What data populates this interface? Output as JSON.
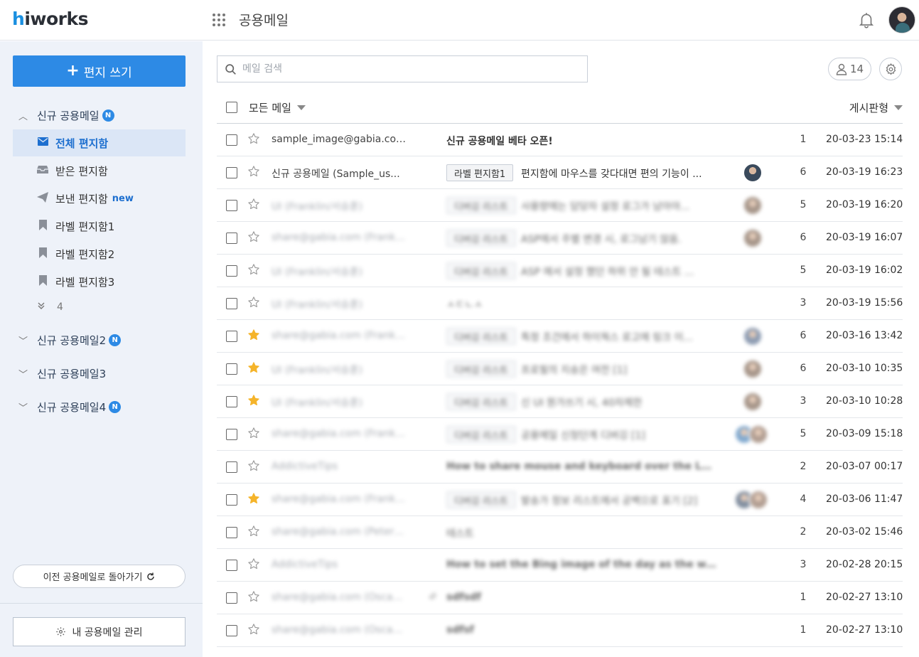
{
  "header": {
    "logo_prefix": "h",
    "logo_rest": "iworks",
    "app_title": "공용메일"
  },
  "sidebar": {
    "compose_label": "편지 쓰기",
    "mailboxes": [
      {
        "name": "신규 공용메일",
        "badge": "N",
        "expanded": true
      },
      {
        "name": "신규 공용메일2",
        "badge": "N",
        "expanded": false
      },
      {
        "name": "신규 공용메일3",
        "badge": "",
        "expanded": false
      },
      {
        "name": "신규 공용메일4",
        "badge": "N",
        "expanded": false
      }
    ],
    "folders": [
      {
        "label": "전체 편지함",
        "icon": "envelope-icon",
        "active": true,
        "tag": ""
      },
      {
        "label": "받은 편지함",
        "icon": "inbox-icon",
        "active": false,
        "tag": ""
      },
      {
        "label": "보낸 편지함",
        "icon": "send-icon",
        "active": false,
        "tag": "new"
      },
      {
        "label": "라벨 편지함1",
        "icon": "bookmark-icon",
        "active": false,
        "tag": ""
      },
      {
        "label": "라벨 편지함2",
        "icon": "bookmark-icon",
        "active": false,
        "tag": ""
      },
      {
        "label": "라벨 편지함3",
        "icon": "bookmark-icon",
        "active": false,
        "tag": ""
      }
    ],
    "more_count": "4",
    "back_label": "이전 공용메일로 돌아가기",
    "manage_label": "내 공용메일 관리"
  },
  "toolbar": {
    "search_placeholder": "메일 검색",
    "member_count": "14",
    "filter_label": "모든 메일",
    "view_label": "게시판형"
  },
  "colors": {
    "accent": "#2d8ae5",
    "star_filled": "#f5b42a",
    "sidebar_bg": "#eef2f9"
  },
  "mails": [
    {
      "sender": "sample_image@gabia.com...",
      "label": "",
      "subject": "신규 공용메일 베타 오픈!",
      "bold": true,
      "count": "1",
      "date": "20-03-23 15:14",
      "starred": false,
      "blur": false,
      "avatars": [],
      "clip": false
    },
    {
      "sender": "신규 공용메일 (Sample_us...",
      "label": "라벨 편지함1",
      "subject": "편지함에 마우스를 갖다대면 편의 기능이 ...",
      "bold": false,
      "count": "6",
      "date": "20-03-19 16:23",
      "starred": false,
      "blur": false,
      "avatars": [
        "#3a4a5c"
      ],
      "clip": false
    },
    {
      "sender": "UI (Franklin/서승훈)",
      "label": "디버깅 리스트",
      "subject": "사용량에는 담당자 설정 로그가 남아야...",
      "bold": false,
      "count": "5",
      "date": "20-03-19 16:20",
      "starred": false,
      "blur": true,
      "avatars": [
        "#8b7565"
      ],
      "clip": false
    },
    {
      "sender": "share@gabia.com (Frankli...",
      "label": "디버깅 리스트",
      "subject": "ASP에서 주별 변경 시, 로그남기 않음.",
      "bold": false,
      "count": "6",
      "date": "20-03-19 16:07",
      "starred": false,
      "blur": true,
      "avatars": [
        "#8b7565"
      ],
      "clip": false
    },
    {
      "sender": "UI (Franklin/서승훈)",
      "label": "디버깅 리스트",
      "subject": "ASP 에서 설정 했던 하위 안 될 테스트 ...",
      "bold": false,
      "count": "5",
      "date": "20-03-19 16:02",
      "starred": false,
      "blur": true,
      "avatars": [],
      "clip": false
    },
    {
      "sender": "UI (Franklin/서승훈)",
      "label": "",
      "subject": "ㅅㄷㄴㅅ",
      "bold": false,
      "count": "3",
      "date": "20-03-19 15:56",
      "starred": false,
      "blur": true,
      "avatars": [],
      "clip": false
    },
    {
      "sender": "share@gabia.com (Frankli...",
      "label": "디버깅 리스트",
      "subject": "특정 조건에서 하이웍스 로고에 링크 이...",
      "bold": false,
      "count": "6",
      "date": "20-03-16 13:42",
      "starred": true,
      "blur": true,
      "avatars": [
        "#6a7d9a"
      ],
      "clip": false
    },
    {
      "sender": "UI (Franklin/서승훈)",
      "label": "디버깅 리스트",
      "subject": "프로필의 지송은 여전 [1]",
      "bold": false,
      "count": "6",
      "date": "20-03-10 10:35",
      "starred": true,
      "blur": true,
      "avatars": [
        "#8b7565"
      ],
      "clip": false
    },
    {
      "sender": "UI (Franklin/서승훈)",
      "label": "디버깅 리스트",
      "subject": "신 UI 뭔가쓰기 시, 40자제한",
      "bold": false,
      "count": "3",
      "date": "20-03-10 10:28",
      "starred": true,
      "blur": true,
      "avatars": [
        "#8b7565"
      ],
      "clip": false
    },
    {
      "sender": "share@gabia.com (Frankli...",
      "label": "디버깅 리스트",
      "subject": "공용메일 신청단계 디버깅 [1]",
      "bold": false,
      "count": "5",
      "date": "20-03-09 15:18",
      "starred": false,
      "blur": true,
      "avatars": [
        "#5b8fc0",
        "#9a8070"
      ],
      "clip": false
    },
    {
      "sender": "AddictiveTips",
      "label": "",
      "subject": "How to share mouse and keyboard over the LAN on Li...",
      "bold": true,
      "count": "2",
      "date": "20-03-07 00:17",
      "starred": false,
      "blur": true,
      "avatars": [],
      "clip": false
    },
    {
      "sender": "share@gabia.com (Frankli...",
      "label": "디버깅 리스트",
      "subject": "발송가 정보 리스트에서 공백으로 표기 [2]",
      "bold": false,
      "count": "4",
      "date": "20-03-06 11:47",
      "starred": true,
      "blur": true,
      "avatars": [
        "#5a6b82",
        "#9a8070"
      ],
      "clip": false
    },
    {
      "sender": "share@gabia.com (Peter/...",
      "label": "",
      "subject": "테스트",
      "bold": false,
      "count": "2",
      "date": "20-03-02 15:46",
      "starred": false,
      "blur": true,
      "avatars": [],
      "clip": false
    },
    {
      "sender": "AddictiveTips",
      "label": "",
      "subject": "How to set the Bing image of the day as the wallpape...",
      "bold": true,
      "count": "3",
      "date": "20-02-28 20:15",
      "starred": false,
      "blur": true,
      "avatars": [],
      "clip": false
    },
    {
      "sender": "share@gabia.com (Oscar/...",
      "label": "",
      "subject": "sdfsdf",
      "bold": true,
      "count": "1",
      "date": "20-02-27 13:10",
      "starred": false,
      "blur": true,
      "avatars": [],
      "clip": true
    },
    {
      "sender": "share@gabia.com (Oscar/...",
      "label": "",
      "subject": "sdfsf",
      "bold": true,
      "count": "1",
      "date": "20-02-27 13:10",
      "starred": false,
      "blur": true,
      "avatars": [],
      "clip": false
    }
  ]
}
